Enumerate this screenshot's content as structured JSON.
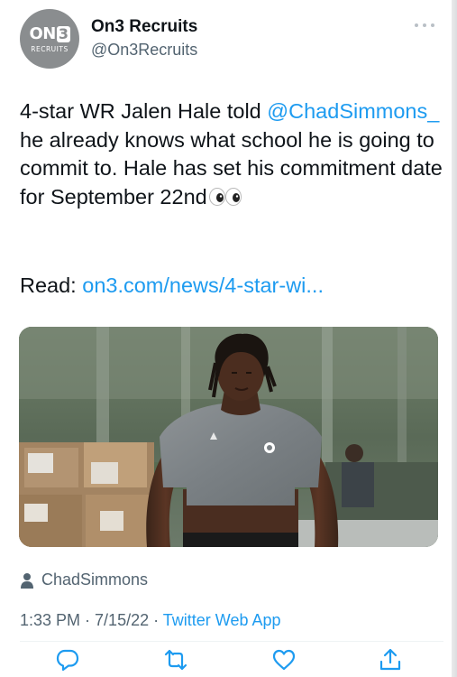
{
  "account": {
    "display_name": "On3 Recruits",
    "handle": "@On3Recruits",
    "avatar_logo_main": "ON",
    "avatar_logo_number": "3",
    "avatar_logo_sub": "RECRUITS"
  },
  "tweet": {
    "text_part1": "4-star WR Jalen Hale told ",
    "mention": "@ChadSimmons_",
    "text_part2": " he already knows what school he is going to commit to. Hale has set his commitment date for September 22nd",
    "emoji_icon": "eyes-emoji",
    "read_label": "Read: ",
    "read_link": "on3.com/news/4-star-wi..."
  },
  "media": {
    "photo_credit": "ChadSimmons"
  },
  "meta": {
    "time": "1:33 PM",
    "separator1": " · ",
    "date": "7/15/22",
    "separator2": " · ",
    "source": "Twitter Web App"
  },
  "actions": [
    {
      "name": "reply",
      "icon": "reply-icon"
    },
    {
      "name": "retweet",
      "icon": "retweet-icon"
    },
    {
      "name": "like",
      "icon": "heart-icon"
    },
    {
      "name": "share",
      "icon": "share-icon"
    }
  ],
  "colors": {
    "link": "#1d9bf0",
    "secondary_text": "#536471",
    "primary_text": "#0f1419"
  }
}
